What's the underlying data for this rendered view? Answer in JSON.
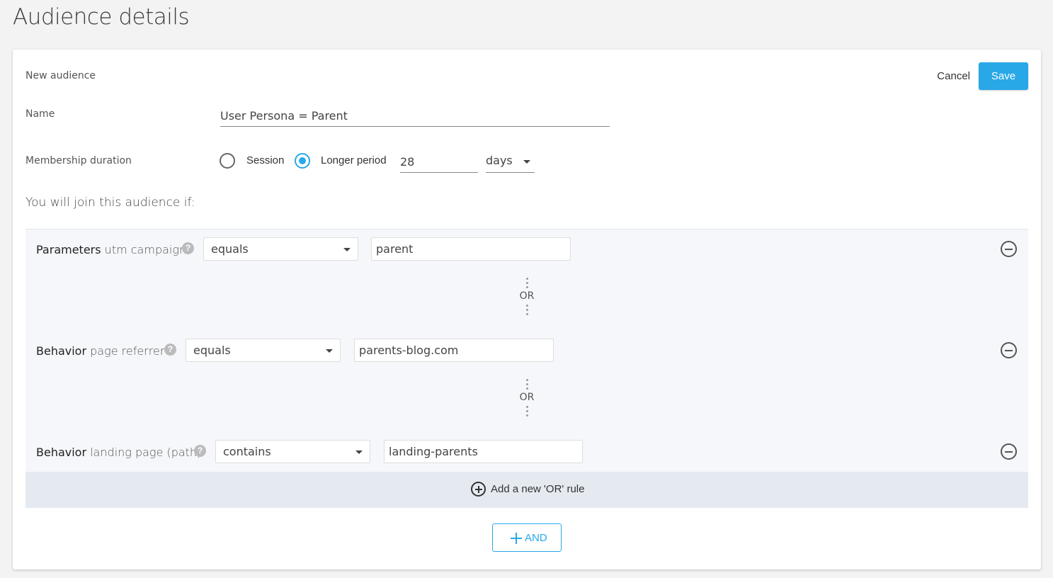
{
  "page": {
    "title": "Audience details"
  },
  "form": {
    "header_label": "New audience",
    "cancel_label": "Cancel",
    "save_label": "Save",
    "name_label": "Name",
    "name_value": "User Persona = Parent",
    "duration_label": "Membership duration",
    "duration_options": [
      {
        "label": "Session",
        "selected": false
      },
      {
        "label": "Longer period",
        "selected": true
      }
    ],
    "duration_value": "28",
    "duration_unit": "days",
    "join_text": "You will join this audience if:"
  },
  "rules": [
    {
      "kind": "Parameters",
      "attribute": "utm campaign",
      "operator": "equals",
      "value": "parent"
    },
    {
      "kind": "Behavior",
      "attribute": "page referrer",
      "operator": "equals",
      "value": "parents-blog.com"
    },
    {
      "kind": "Behavior",
      "attribute": "landing page (path)",
      "operator": "contains",
      "value": "landing-parents"
    }
  ],
  "or_label": "OR",
  "help_glyph": "?",
  "add_or_label": "Add a new 'OR' rule",
  "and_label": "AND",
  "colors": {
    "accent": "#29a8e8",
    "rules_bg": "#f5f7fa",
    "add_or_bg": "#e5eaf1"
  }
}
